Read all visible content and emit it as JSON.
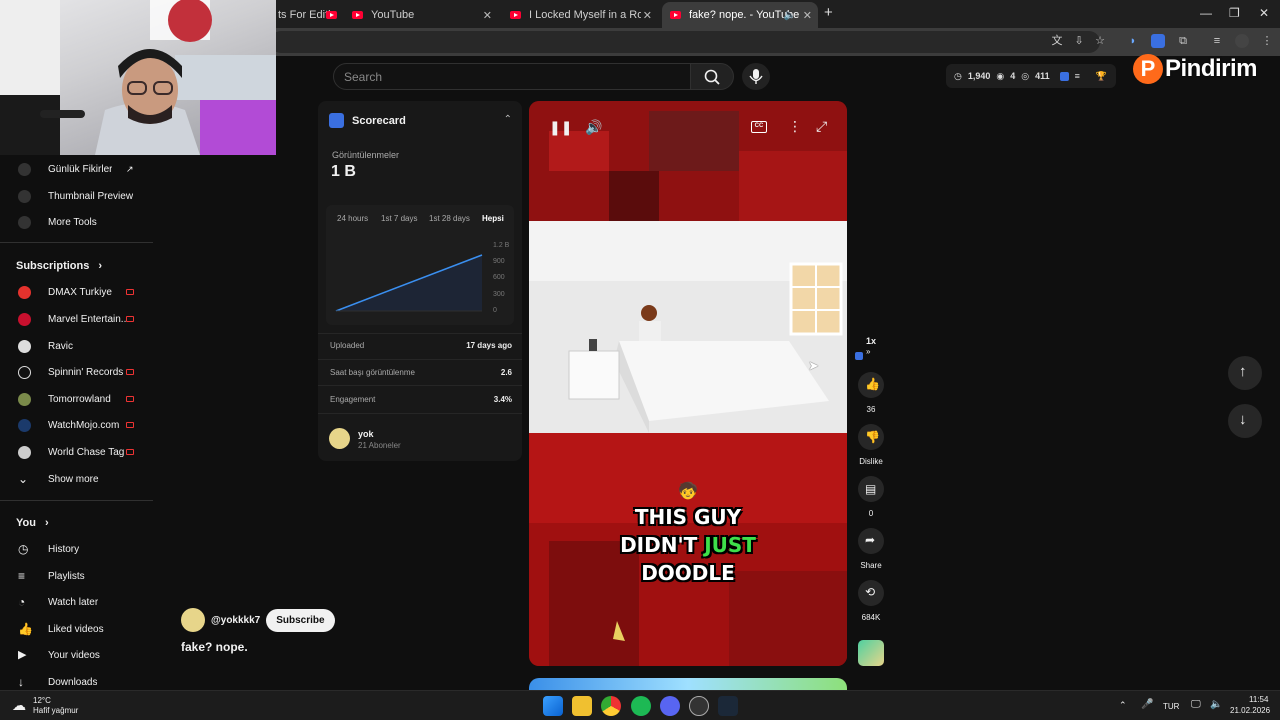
{
  "browser": {
    "tabs": [
      {
        "title": "ts For Editin",
        "active": false
      },
      {
        "title": "YouTube",
        "active": false
      },
      {
        "title": "I Locked Myself in a Room Unt",
        "active": false
      },
      {
        "title": "fake? nope. - YouTube",
        "active": true
      }
    ],
    "new_tab": "+",
    "window_controls": [
      "—",
      "❐",
      "✕"
    ]
  },
  "youtube": {
    "search_placeholder": "Search",
    "stats": {
      "views": "1,940",
      "likes": "4",
      "watching": "411"
    },
    "brand_logo_text": "Pindirim",
    "brand_color": "#ff6a1a"
  },
  "sidebar": {
    "tools": [
      {
        "label": "Günlük Fikirler"
      },
      {
        "label": "Thumbnail Preview"
      },
      {
        "label": "More Tools"
      }
    ],
    "subscriptions_title": "Subscriptions",
    "subscriptions": [
      {
        "label": "DMAX Turkiye",
        "color": "#e5322d"
      },
      {
        "label": "Marvel Entertain...",
        "color": "#c8102e"
      },
      {
        "label": "Ravic",
        "color": "#dddddd"
      },
      {
        "label": "Spinnin' Records",
        "color": "#111111"
      },
      {
        "label": "Tomorrowland",
        "color": "#7a8a4a"
      },
      {
        "label": "WatchMojo.com",
        "color": "#1b3a6b"
      },
      {
        "label": "World Chase Tag",
        "color": "#cccccc"
      }
    ],
    "show_more": "Show more",
    "you_title": "You",
    "you_items": [
      {
        "label": "History"
      },
      {
        "label": "Playlists"
      },
      {
        "label": "Watch later"
      },
      {
        "label": "Liked videos"
      },
      {
        "label": "Your videos"
      },
      {
        "label": "Downloads"
      }
    ]
  },
  "scorecard": {
    "title": "Scorecard",
    "views_label": "Görüntülenmeler",
    "views_value": "1 B",
    "ranges": [
      "24 hours",
      "1st 7 days",
      "1st 28 days",
      "Hepsi"
    ],
    "active_range": "Hepsi",
    "chart_ticks": [
      "1.2 B",
      "900",
      "600",
      "300",
      "0"
    ],
    "rows": [
      {
        "label": "Uploaded",
        "value": "17 days ago"
      },
      {
        "label": "Saat başı görüntülenme",
        "value": "2.6"
      },
      {
        "label": "Engagement",
        "value": "3.4%"
      }
    ],
    "channel_name": "yok",
    "channel_subs": "21 Aboneler"
  },
  "player": {
    "caption_lines": [
      "THIS GUY",
      "DIDN'T",
      "JUST",
      "DOODLE"
    ],
    "caption_highlight_color": "#3ee04a",
    "emoji": "🧒"
  },
  "actions": {
    "speed": "1x",
    "likes": "36",
    "dislike_label": "Dislike",
    "comments": "0",
    "share_label": "Share",
    "remix_count": "684K"
  },
  "channel": {
    "handle": "@yokkkk7",
    "subscribe_label": "Subscribe",
    "short_title": "fake? nope."
  },
  "taskbar": {
    "weather_temp": "12°C",
    "weather_desc": "Hafif yağmur",
    "lang": "TUR",
    "time": "11:54",
    "date": "21.02.2026"
  }
}
